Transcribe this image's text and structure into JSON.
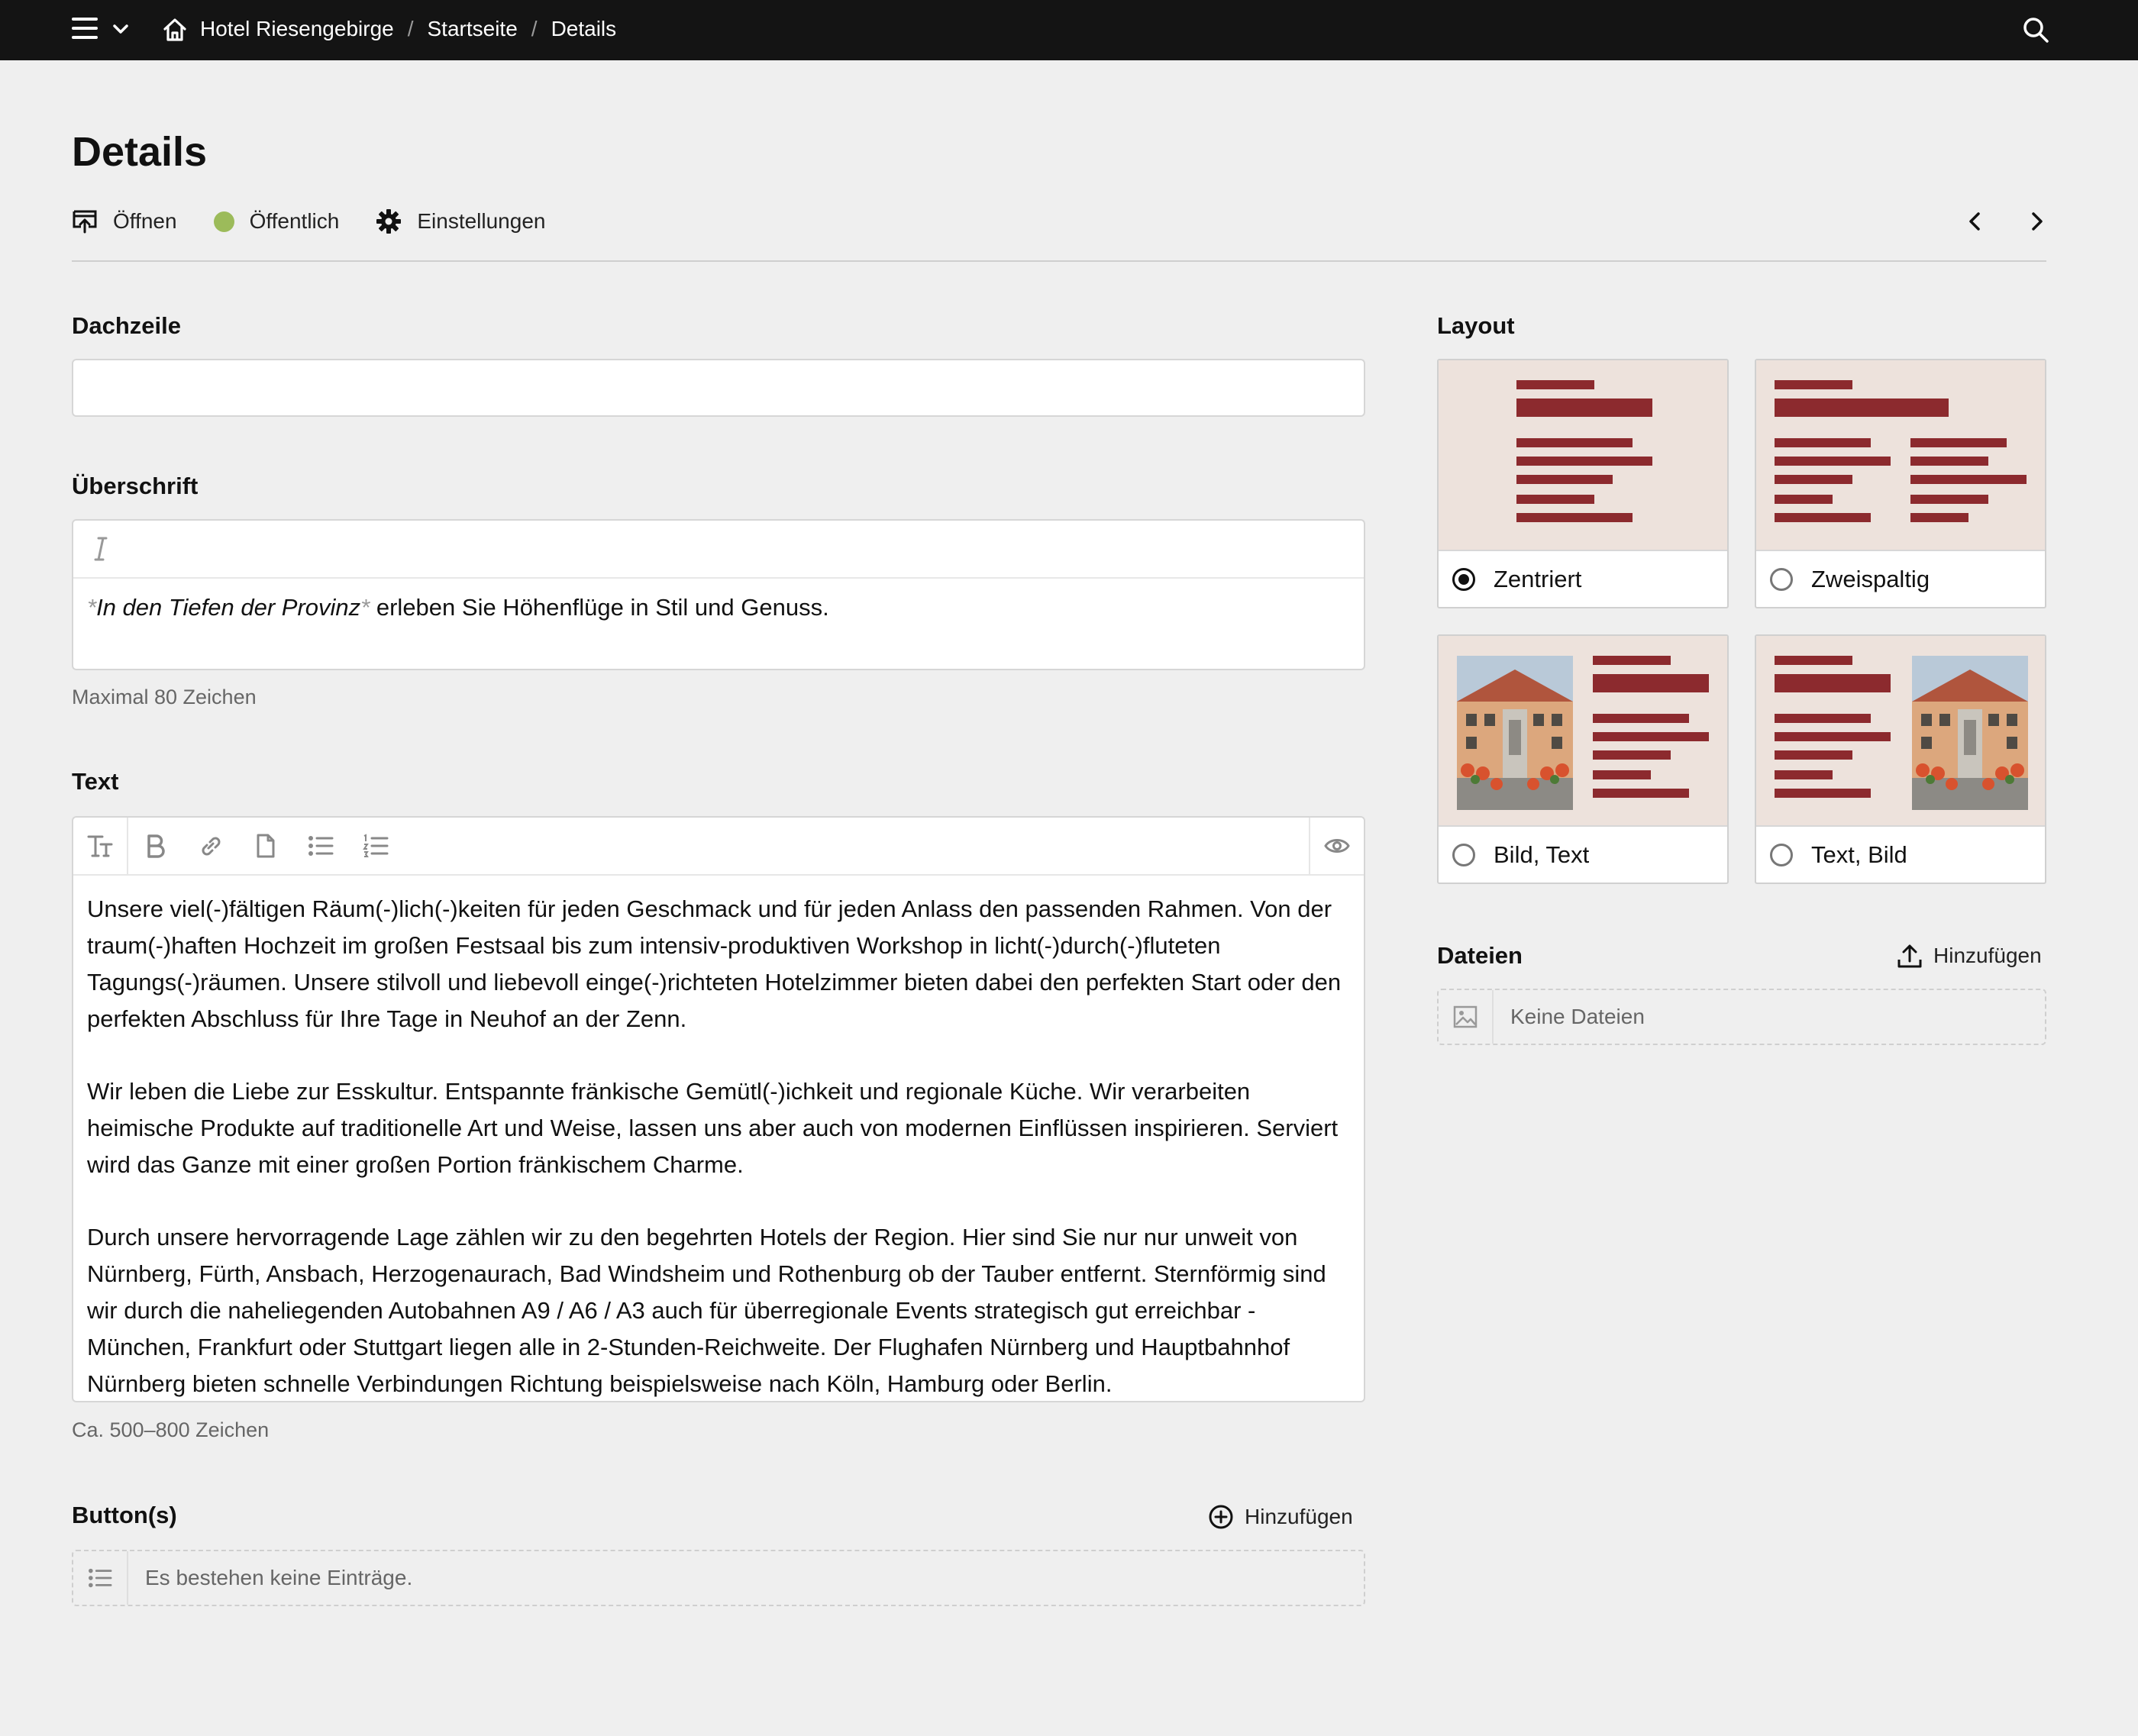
{
  "topbar": {
    "icons": [
      "menu-icon",
      "chevron-down-icon",
      "home-icon",
      "search-icon"
    ],
    "breadcrumb": [
      "Hotel Riesengebirge",
      "Startseite",
      "Details"
    ]
  },
  "page": {
    "title": "Details",
    "actions": {
      "open": "Öffnen",
      "status": "Öffentlich",
      "status_color": "#9cbb5a",
      "settings": "Einstellungen"
    }
  },
  "fields": {
    "dachzeile": {
      "label": "Dachzeile",
      "value": ""
    },
    "ueberschrift": {
      "label": "Überschrift",
      "marker_open": "*",
      "emphasis": "In den Tiefen der Provinz",
      "marker_close": "*",
      "rest": " erleben Sie Höhenflüge in Stil und Genuss.",
      "help": "Maximal 80 Zeichen"
    },
    "text": {
      "label": "Text",
      "toolbar": [
        "text-size-icon",
        "bold-icon",
        "link-icon",
        "file-icon",
        "bullet-list-icon",
        "numbered-list-icon",
        "eye-icon"
      ],
      "paragraphs": [
        "Unsere viel(-)fältigen Räum(-)lich(-)keiten für jeden Geschmack und für jeden Anlass den passenden Rahmen. Von der traum(-)haften Hochzeit im großen Festsaal bis zum intensiv-produktiven Workshop in licht(-)durch(-)fluteten Tagungs(-)räumen. Unsere stilvoll und liebevoll einge(-)richteten Hotelzimmer bieten dabei den perfekten Start oder den perfekten Abschluss für Ihre Tage in Neuhof an der Zenn.",
        "Wir leben die Liebe zur Esskultur. Entspannte fränkische Gemütl(-)ichkeit und regionale Küche. Wir verarbeiten heimische Produkte auf traditionelle Art und Weise, lassen uns aber auch von modernen Einflüssen inspirieren. Serviert wird das Ganze mit einer großen Portion fränkischem Charme.",
        "Durch unsere hervorragende Lage zählen wir zu den begehrten Hotels der Region. Hier sind Sie nur nur unweit von Nürnberg, Fürth, Ansbach, Herzogenaurach, Bad Windsheim und Rothenburg ob der Tauber entfernt. Sternförmig sind wir durch die naheliegenden Autobahnen A9 / A6 / A3 auch für überregionale Events strategisch gut erreichbar - München, Frankfurt oder Stuttgart liegen alle in 2-Stunden-Reichweite. Der Flughafen Nürnberg und Hauptbahnhof Nürnberg bieten schnelle Verbindungen Richtung beispielsweise nach Köln, Hamburg oder Berlin."
      ],
      "help": "Ca. 500–800 Zeichen"
    },
    "buttons": {
      "label": "Button(s)",
      "add": "Hinzufügen",
      "empty": "Es bestehen keine Einträge."
    }
  },
  "layout": {
    "label": "Layout",
    "options": [
      {
        "label": "Zentriert",
        "selected": true
      },
      {
        "label": "Zweispaltig",
        "selected": false
      },
      {
        "label": "Bild, Text",
        "selected": false
      },
      {
        "label": "Text, Bild",
        "selected": false
      }
    ],
    "bar_color": "#8c2a2e",
    "preview_bg": "#ede2dc"
  },
  "files": {
    "label": "Dateien",
    "add": "Hinzufügen",
    "empty": "Keine Dateien"
  }
}
